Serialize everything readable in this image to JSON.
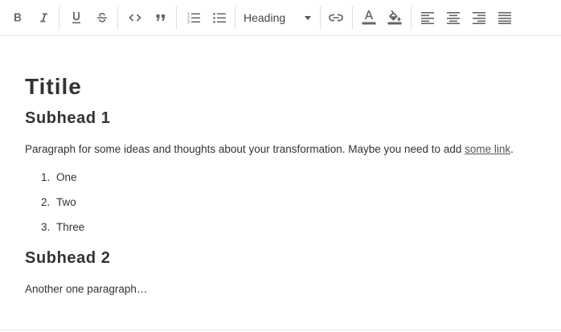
{
  "toolbar": {
    "buttons": [
      {
        "name": "bold",
        "icon": "bold-icon",
        "glyph": "B"
      },
      {
        "name": "italic",
        "icon": "italic-icon",
        "glyph": "I"
      },
      {
        "name": "underline",
        "icon": "underline-icon"
      },
      {
        "name": "strikethrough",
        "icon": "strikethrough-icon"
      },
      {
        "name": "code",
        "icon": "code-icon"
      },
      {
        "name": "quote",
        "icon": "quote-icon"
      },
      {
        "name": "ordered-list",
        "icon": "ordered-list-icon"
      },
      {
        "name": "bullet-list",
        "icon": "bullet-list-icon"
      },
      {
        "name": "link",
        "icon": "link-icon"
      },
      {
        "name": "text-color",
        "icon": "text-color-icon"
      },
      {
        "name": "highlight-color",
        "icon": "fill-color-icon"
      },
      {
        "name": "align-left",
        "icon": "align-left-icon"
      },
      {
        "name": "align-center",
        "icon": "align-center-icon"
      },
      {
        "name": "align-right",
        "icon": "align-right-icon"
      },
      {
        "name": "align-justify",
        "icon": "align-justify-icon"
      }
    ],
    "block_format": {
      "selected": "Heading"
    }
  },
  "document": {
    "title": "Titile",
    "subhead1": "Subhead 1",
    "paragraph1_text": "Paragraph for some ideas and thoughts about your transformation. Maybe you need to add ",
    "paragraph1_link": "some link",
    "paragraph1_end": ".",
    "list": [
      {
        "num": "1.",
        "text": "One"
      },
      {
        "num": "2.",
        "text": "Two"
      },
      {
        "num": "3.",
        "text": "Three"
      }
    ],
    "subhead2": "Subhead 2",
    "paragraph2": "Another one paragraph…"
  },
  "colors": {
    "icon": "#666666",
    "text": "#333333",
    "divider": "#e0e0e0"
  }
}
